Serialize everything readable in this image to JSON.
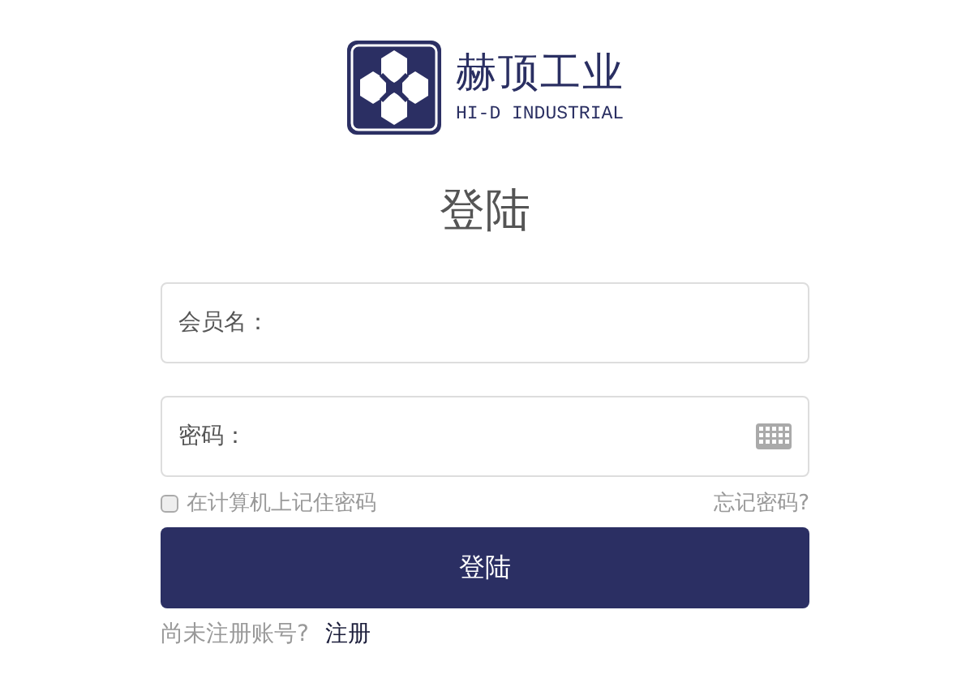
{
  "logo": {
    "name": "赫顶工业",
    "subtitle": "HI-D INDUSTRIAL"
  },
  "title": "登陆",
  "fields": [
    {
      "label": "会员名：",
      "kind": "text"
    },
    {
      "label": "密码：",
      "kind": "password"
    }
  ],
  "remember": {
    "label": "在计算机上记住密码",
    "checked": false
  },
  "forgot_link": "忘记密码?",
  "submit": "登陆",
  "register": {
    "prompt": "尚未注册账号?",
    "link": "注册"
  }
}
